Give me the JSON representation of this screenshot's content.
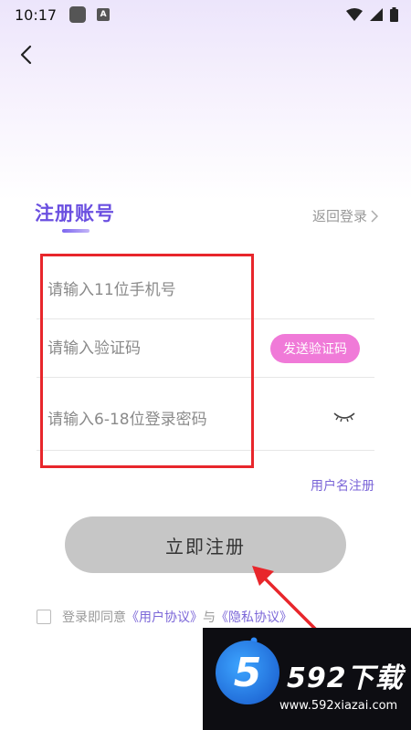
{
  "status_bar": {
    "time": "10:17",
    "app_badge": "A"
  },
  "header": {
    "title": "注册账号",
    "back_login": "返回登录"
  },
  "form": {
    "phone": {
      "placeholder": "请输入11位手机号",
      "value": ""
    },
    "code": {
      "placeholder": "请输入验证码",
      "value": ""
    },
    "send_code_label": "发送验证码",
    "password": {
      "placeholder": "请输入6-18位登录密码",
      "value": ""
    },
    "username_register": "用户名注册",
    "submit_label": "立即注册"
  },
  "agreement": {
    "prefix": "登录即同意",
    "user_agreement": "《用户协议》",
    "conjunction": "与",
    "privacy_policy": "《隐私协议》",
    "checked": false
  },
  "watermark": {
    "logo_char": "5",
    "title": "592下载",
    "url": "www.592xiazai.com"
  },
  "colors": {
    "accent": "#6a4fe0",
    "send_code_bg": "#f07ad8",
    "submit_bg": "#c6c6c6",
    "highlight": "#e8262b"
  }
}
